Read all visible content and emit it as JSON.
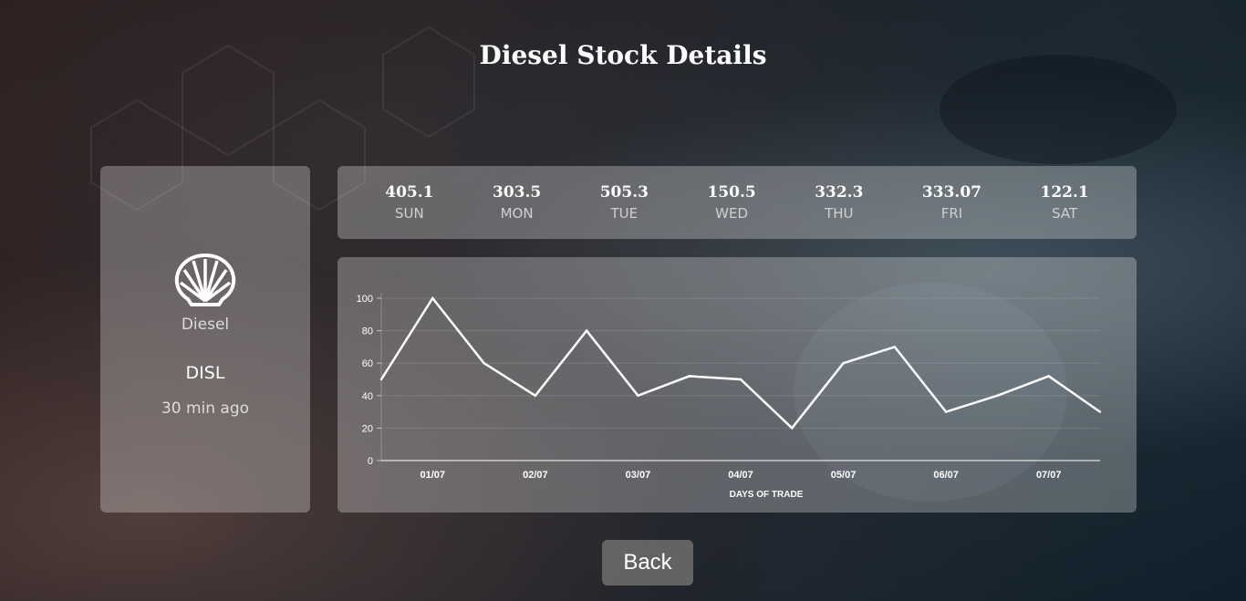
{
  "page": {
    "title": "Diesel Stock Details"
  },
  "stock": {
    "icon": "shell-logo-icon",
    "name": "Diesel",
    "ticker": "DISL",
    "updated": "30 min ago"
  },
  "days": [
    {
      "value": "405.1",
      "name": "SUN"
    },
    {
      "value": "303.5",
      "name": "MON"
    },
    {
      "value": "505.3",
      "name": "TUE"
    },
    {
      "value": "150.5",
      "name": "WED"
    },
    {
      "value": "332.3",
      "name": "THU"
    },
    {
      "value": "333.07",
      "name": "FRI"
    },
    {
      "value": "122.1",
      "name": "SAT"
    }
  ],
  "chart_data": {
    "type": "line",
    "xlabel": "DAYS OF TRADE",
    "ylabel": "",
    "ylim": [
      0,
      100
    ],
    "yticks": [
      0,
      20,
      40,
      60,
      80,
      100
    ],
    "xticks": [
      "01/07",
      "02/07",
      "03/07",
      "04/07",
      "05/07",
      "06/07",
      "07/07"
    ],
    "grid": true,
    "series": [
      {
        "values": [
          50,
          100,
          60,
          40,
          80,
          40,
          52,
          50,
          20,
          60,
          70,
          30,
          40,
          52,
          30
        ],
        "color": "#ffffff"
      }
    ]
  },
  "back_button": {
    "label": "Back"
  }
}
